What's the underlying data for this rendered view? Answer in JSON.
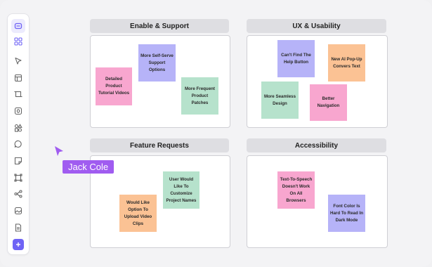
{
  "toolbar": {
    "tools": [
      {
        "icon": "board-icon",
        "state": "active"
      },
      {
        "icon": "grid-icon"
      },
      {
        "icon": "pointer-icon"
      },
      {
        "icon": "layout-icon"
      },
      {
        "icon": "frame-icon"
      },
      {
        "icon": "text-icon"
      },
      {
        "icon": "shapes-icon"
      },
      {
        "icon": "comment-icon"
      },
      {
        "icon": "sticky-note-icon"
      },
      {
        "icon": "crop-icon"
      },
      {
        "icon": "connector-icon"
      },
      {
        "icon": "image-icon"
      },
      {
        "icon": "document-icon"
      },
      {
        "icon": "add-icon",
        "state": "accent"
      }
    ],
    "accent_color": "#6f63f5"
  },
  "sections": {
    "enable_support": {
      "title": "Enable & Support",
      "notes": {
        "n1": "Detailed Product Tutorial Videos",
        "n2": "More Self-Serve Support Options",
        "n3": "More Frequent Product Patches"
      }
    },
    "ux_usability": {
      "title": "UX & Usability",
      "notes": {
        "n1": "Can't Find The Help Button",
        "n2": "New AI Pop-Up Convers Text",
        "n3": "More Seamless Design",
        "n4": "Better Navigation"
      }
    },
    "feature_requests": {
      "title": "Feature Requests",
      "notes": {
        "n1": "User Would Like To Customize Project Names",
        "n2": "Would Like Option To Upload Video Clips"
      }
    },
    "accessibility": {
      "title": "Accessibility",
      "notes": {
        "n1": "Text-To-Speech Doesn't Work On All Browsers",
        "n2": "Font Color Is Hard To Read In Dark Mode"
      }
    }
  },
  "colors": {
    "pink": "#f8a6cf",
    "purple": "#b6b3f8",
    "green": "#b6e2cc",
    "orange": "#fbc294",
    "cursor": "#a05cf0"
  },
  "cursor": {
    "user_name": "Jack Cole"
  }
}
